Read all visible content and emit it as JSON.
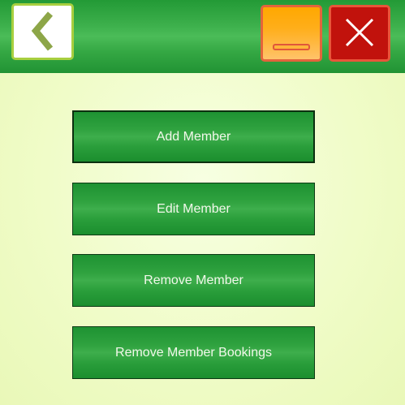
{
  "header": {
    "back_icon": "chevron-left-icon",
    "minimize_icon": "minimize-icon",
    "close_icon": "close-icon",
    "colors": {
      "header_green": "#35a844",
      "back_border": "#a8cf3f",
      "back_chevron": "#8da648",
      "minimize_fill": "#ffa800",
      "minimize_border": "#e3643c",
      "close_fill": "#c1120c",
      "close_border": "#e8553a"
    }
  },
  "menu": {
    "buttons": [
      {
        "label": "Add Member"
      },
      {
        "label": "Edit Member"
      },
      {
        "label": "Remove Member"
      },
      {
        "label": "Remove Member Bookings"
      }
    ]
  },
  "colors": {
    "background": "#f0fcc8",
    "button_green": "#2fa23f",
    "button_text": "#f1f8ea"
  }
}
